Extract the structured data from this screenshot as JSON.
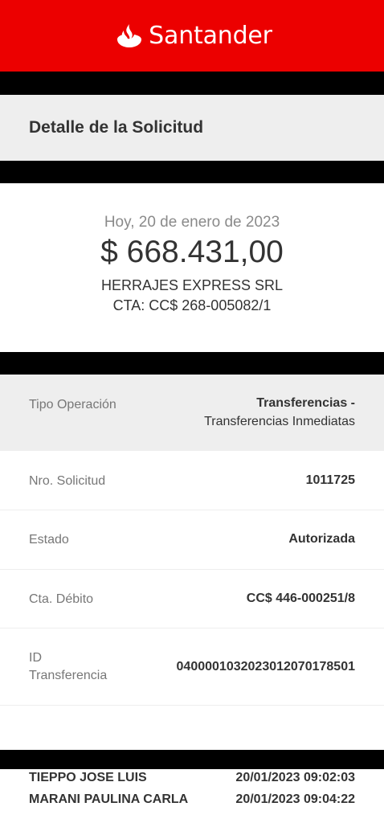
{
  "header": {
    "brand": "Santander",
    "brand_icon": "flame-icon",
    "brand_color": "#ec0000"
  },
  "page": {
    "title": "Detalle de la Solicitud"
  },
  "summary": {
    "date": "Hoy, 20 de enero de 2023",
    "amount": "$ 668.431,00",
    "beneficiary": "HERRAJES EXPRESS SRL",
    "account": "CTA: CC$ 268-005082/1"
  },
  "details": {
    "tipo_operacion": {
      "label": "Tipo Operación",
      "value_line1": "Transferencias -",
      "value_line2": "Transferencias Inmediatas"
    },
    "nro_solicitud": {
      "label": "Nro. Solicitud",
      "value": "1011725"
    },
    "estado": {
      "label": "Estado",
      "value": "Autorizada"
    },
    "cta_debito": {
      "label": "Cta. Débito",
      "value": "CC$ 446-000251/8"
    },
    "id_transferencia": {
      "label_line1": "ID",
      "label_line2": "Transferencia",
      "value": "040000103202301207017850​1"
    }
  },
  "signers": [
    {
      "name": "TIEPPO  JOSE LUIS",
      "datetime": "20/01/2023 09:02:03"
    },
    {
      "name": "MARANI  PAULINA CARLA",
      "datetime": "20/01/2023 09:04:22"
    }
  ]
}
